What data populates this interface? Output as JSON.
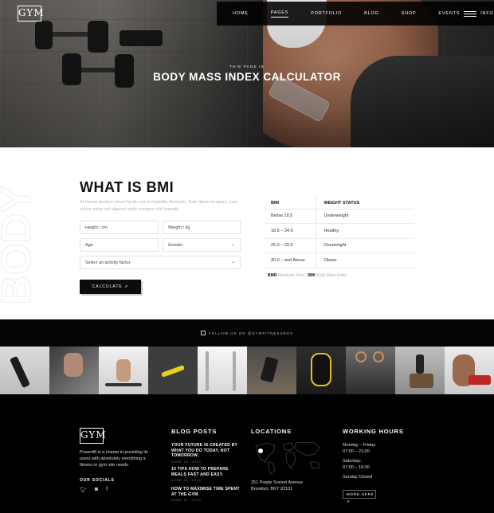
{
  "header": {
    "logo": "GYM",
    "nav": [
      "HOME",
      "PAGES",
      "PORTFOLIO",
      "BLOG",
      "SHOP",
      "EVENTS",
      "INFO"
    ],
    "kicker": "THIS PAGE IS",
    "title": "BODY MASS INDEX CALCULATOR"
  },
  "main": {
    "watermark": "BODY",
    "title": "WHAT IS BMI",
    "description": "Et harum quidem rerum facilis est et expedita distinctio. Nam libero tempore, cum soluta nobis est eligendi optio cumque nihil impedit.",
    "form": {
      "height": "Height / cm",
      "weight": "Weight / kg",
      "age": "Age",
      "gender": "Gender",
      "activity": "Select an activity factor:",
      "button": "CALCULATE"
    },
    "table": {
      "headers": [
        "BMI",
        "WEIGHT STATUS"
      ],
      "rows": [
        [
          "Below 18.5",
          "Underweight"
        ],
        [
          "18.5 – 24.9",
          "Healthy"
        ],
        [
          "25.0 – 29.9",
          "Overweight"
        ],
        [
          "30.0 – and Above",
          "Obese"
        ]
      ],
      "note_bmr": "BMR",
      "note_bmr_text": "Metabolic Rate /",
      "note_bmi": "BMI",
      "note_bmi_text": "Body Mass Index"
    }
  },
  "instagram": {
    "follow": "FOLLOW US ON @GYMFITNESSBOX"
  },
  "footer": {
    "logo": "GYM",
    "about": "Powerlift is a champ in providing its users with absolutely everything a fitness or gym site needs.",
    "social_heading": "OUR SOCIALS",
    "social_icons": [
      "twitter-icon",
      "instagram-icon",
      "facebook-icon"
    ],
    "blog_heading": "BLOG POSTS",
    "posts": [
      {
        "title": "YOUR FUTURE IS CREATED BY WHAT YOU DO TODAY, NOT TOMORROW.",
        "date": "JUNE 18, 2019"
      },
      {
        "title": "10 TIPS HOW TO PREPARE MEALS FAST AND EASY.",
        "date": "JUNE 21, 2019"
      },
      {
        "title": "HOW TO MAXIMISE TIME SPENT AT THE GYM.",
        "date": "JUNE 21, 2019"
      }
    ],
    "locations_heading": "LOCATIONS",
    "address_line1": "251 Purple Sunset Avenue",
    "address_line2": "Brooklyn, BKY 92101",
    "hours_heading": "WORKING HOURS",
    "hours": [
      "Monday – Friday:",
      "07:00 – 21:00",
      "Saturday:",
      "07:00 – 16:00",
      "Sunday Closed"
    ],
    "more_button": "MORE HERE"
  }
}
